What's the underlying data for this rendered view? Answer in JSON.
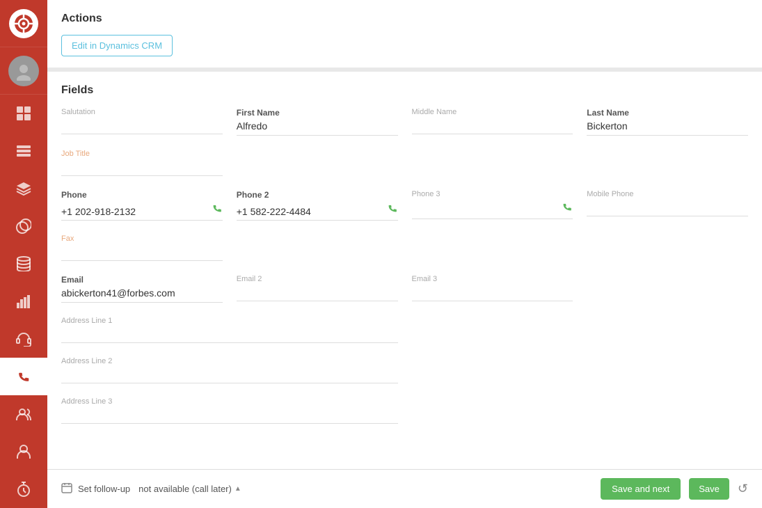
{
  "sidebar": {
    "logo": "🎬",
    "items": [
      {
        "id": "dashboard",
        "icon": "⊞",
        "active": false
      },
      {
        "id": "inbox",
        "icon": "☰",
        "active": false
      },
      {
        "id": "layers",
        "icon": "⧉",
        "active": false
      },
      {
        "id": "coins",
        "icon": "◉",
        "active": false
      },
      {
        "id": "database",
        "icon": "⬟",
        "active": false
      },
      {
        "id": "chart",
        "icon": "▦",
        "active": false
      },
      {
        "id": "headset",
        "icon": "◎",
        "active": false
      },
      {
        "id": "phone",
        "icon": "✆",
        "active": true
      },
      {
        "id": "contacts",
        "icon": "✦",
        "active": false
      },
      {
        "id": "user",
        "icon": "👤",
        "active": false
      },
      {
        "id": "timer",
        "icon": "⏱",
        "active": false
      }
    ]
  },
  "actions": {
    "section_title": "Actions",
    "edit_crm_button": "Edit in Dynamics CRM"
  },
  "fields": {
    "section_title": "Fields",
    "salutation": {
      "label": "Salutation",
      "value": ""
    },
    "first_name": {
      "label": "First Name",
      "value": "Alfredo"
    },
    "middle_name": {
      "label": "Middle Name",
      "value": ""
    },
    "last_name": {
      "label": "Last Name",
      "value": "Bickerton"
    },
    "job_title": {
      "label": "Job Title",
      "value": ""
    },
    "phone": {
      "label": "Phone",
      "value": "+1 202-918-2132"
    },
    "phone2": {
      "label": "Phone 2",
      "value": "+1 582-222-4484"
    },
    "phone3": {
      "label": "Phone 3",
      "value": ""
    },
    "mobile_phone": {
      "label": "Mobile Phone",
      "value": ""
    },
    "fax": {
      "label": "Fax",
      "value": ""
    },
    "email": {
      "label": "Email",
      "value": "abickerton41@forbes.com"
    },
    "email2": {
      "label": "Email 2",
      "value": ""
    },
    "email3": {
      "label": "Email 3",
      "value": ""
    },
    "address_line1": {
      "label": "Address Line 1",
      "value": ""
    },
    "address_line2": {
      "label": "Address Line 2",
      "value": ""
    },
    "address_line3": {
      "label": "Address Line 3",
      "value": ""
    }
  },
  "footer": {
    "follow_up_label": "Set follow-up",
    "follow_up_value": "not available (call later)",
    "save_next_label": "Save and next",
    "save_label": "Save",
    "undo_icon": "↺"
  }
}
